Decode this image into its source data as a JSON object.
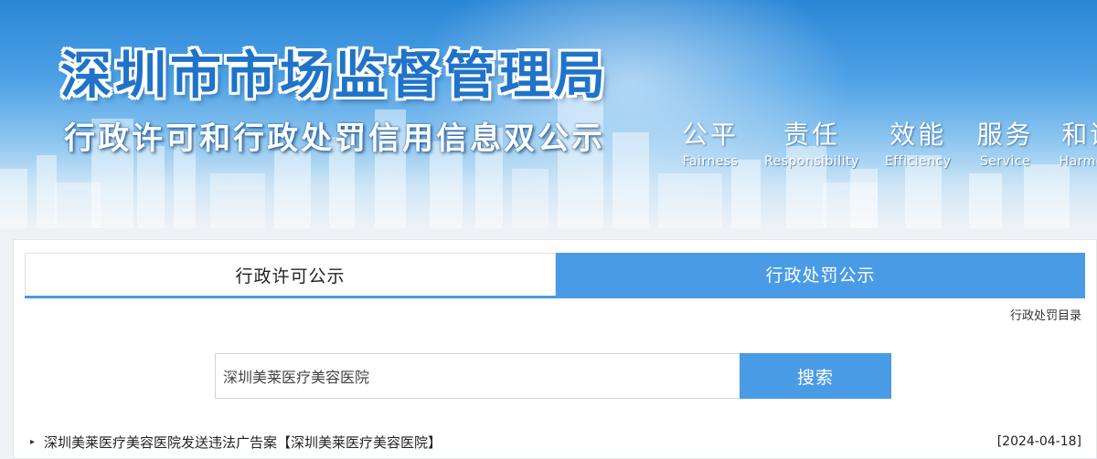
{
  "banner": {
    "title": "深圳市市场监督管理局",
    "subtitle": "行政许可和行政处罚信用信息双公示",
    "values": [
      {
        "cn": "公平",
        "en": "Fairness"
      },
      {
        "cn": "责任",
        "en": "Responsibility"
      },
      {
        "cn": "效能",
        "en": "Efficiency"
      },
      {
        "cn": "服务",
        "en": "Service"
      },
      {
        "cn": "和谐",
        "en": "Harmony"
      }
    ]
  },
  "tabs": [
    {
      "label": "行政许可公示",
      "active": false
    },
    {
      "label": "行政处罚公示",
      "active": true
    }
  ],
  "directory_link": "行政处罚目录",
  "search": {
    "value": "深圳美莱医疗美容医院",
    "button_label": "搜索"
  },
  "results": [
    {
      "marker": "▸",
      "title": "深圳美莱医疗美容医院发送违法广告案【深圳美莱医疗美容医院】",
      "date": "[2024-04-18]"
    }
  ],
  "colors": {
    "accent": "#4a9be6",
    "title_blue": "#1f73c8"
  }
}
